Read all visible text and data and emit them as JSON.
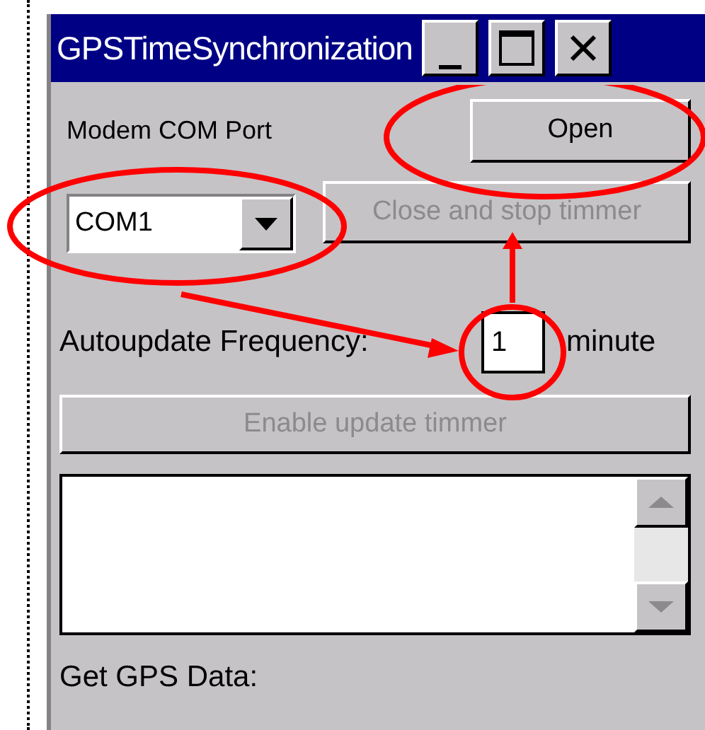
{
  "window": {
    "title": "GPSTimeSynchronization"
  },
  "title_buttons": [
    {
      "kind": "minimize"
    },
    {
      "kind": "maximize"
    },
    {
      "kind": "close"
    }
  ],
  "port_label": "Modem COM Port",
  "open_button": {
    "label": "Open",
    "disabled": false
  },
  "port_select": {
    "value": "COM1"
  },
  "close_button": {
    "label": "Close and stop timmer",
    "disabled": true
  },
  "frequency": {
    "label": "Autoupdate Frequency:",
    "value": "1",
    "unit": "minute"
  },
  "enable_button": {
    "label": "Enable update timmer",
    "disabled": true
  },
  "gps_label": "Get GPS Data:"
}
